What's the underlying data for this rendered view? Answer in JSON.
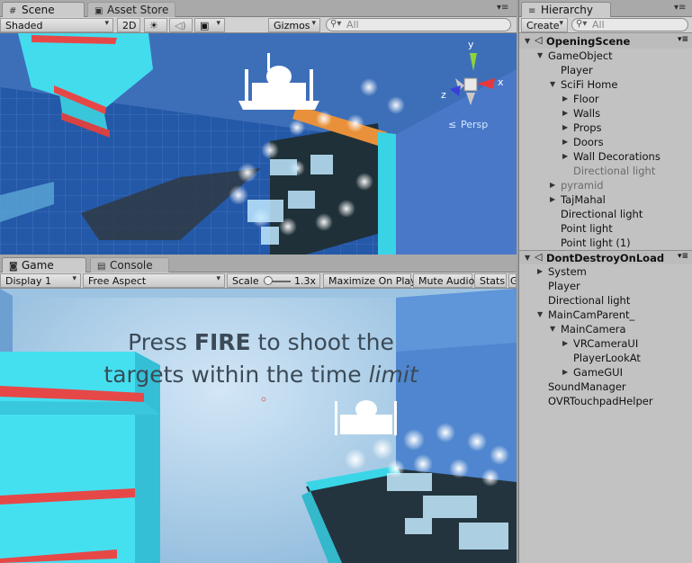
{
  "scene_panel": {
    "tabs": [
      {
        "label": "Scene"
      },
      {
        "label": "Asset Store"
      }
    ],
    "shading_mode": "Shaded",
    "mode_2d": "2D",
    "gizmos": "Gizmos",
    "search_placeholder": "All",
    "gizmo_axis_y": "y",
    "gizmo_axis_x": "x",
    "gizmo_axis_z": "z",
    "persp_label": "Persp"
  },
  "game_panel": {
    "tabs": [
      {
        "label": "Game"
      },
      {
        "label": "Console"
      }
    ],
    "display": "Display 1",
    "aspect": "Free Aspect",
    "scale_label": "Scale",
    "scale_value": "1.3x",
    "maximize_on_play": "Maximize On Play",
    "mute_audio": "Mute Audio",
    "stats": "Stats",
    "gizmos_cut": "G",
    "hud_line1_a": "Press ",
    "hud_line1_b": "FIRE",
    "hud_line1_c": " to shoot the",
    "hud_line2_a": "targets within the time ",
    "hud_line2_b": "limit"
  },
  "hierarchy": {
    "tab": "Hierarchy",
    "create": "Create",
    "search_placeholder": "All",
    "rows": [
      {
        "label": "OpeningScene",
        "depth": 0,
        "arrow": "down",
        "type": "scene"
      },
      {
        "label": "GameObject",
        "depth": 1,
        "arrow": "down"
      },
      {
        "label": "Player",
        "depth": 2,
        "arrow": ""
      },
      {
        "label": "SciFi Home",
        "depth": 2,
        "arrow": "down"
      },
      {
        "label": "Floor",
        "depth": 3,
        "arrow": "right"
      },
      {
        "label": "Walls",
        "depth": 3,
        "arrow": "right"
      },
      {
        "label": "Props",
        "depth": 3,
        "arrow": "right"
      },
      {
        "label": "Doors",
        "depth": 3,
        "arrow": "right"
      },
      {
        "label": "Wall Decorations",
        "depth": 3,
        "arrow": "right"
      },
      {
        "label": "Directional light",
        "depth": 3,
        "arrow": "",
        "dim": true
      },
      {
        "label": "pyramid",
        "depth": 2,
        "arrow": "right",
        "dim": true
      },
      {
        "label": "TajMahal",
        "depth": 2,
        "arrow": "right"
      },
      {
        "label": "Directional light",
        "depth": 2,
        "arrow": ""
      },
      {
        "label": "Point light",
        "depth": 2,
        "arrow": ""
      },
      {
        "label": "Point light (1)",
        "depth": 2,
        "arrow": ""
      },
      {
        "label": "DontDestroyOnLoad",
        "depth": 0,
        "arrow": "down",
        "type": "scene2"
      },
      {
        "label": "System",
        "depth": 1,
        "arrow": "right"
      },
      {
        "label": "Player",
        "depth": 1,
        "arrow": ""
      },
      {
        "label": "Directional light",
        "depth": 1,
        "arrow": ""
      },
      {
        "label": "MainCamParent_",
        "depth": 1,
        "arrow": "down"
      },
      {
        "label": "MainCamera",
        "depth": 2,
        "arrow": "down"
      },
      {
        "label": "VRCameraUI",
        "depth": 3,
        "arrow": "right"
      },
      {
        "label": "PlayerLookAt",
        "depth": 3,
        "arrow": ""
      },
      {
        "label": "GameGUI",
        "depth": 3,
        "arrow": "right"
      },
      {
        "label": "SoundManager",
        "depth": 1,
        "arrow": ""
      },
      {
        "label": "OVRTouchpadHelper",
        "depth": 1,
        "arrow": ""
      }
    ]
  },
  "colors": {
    "editor_bg": "#a2a2a2",
    "scene_wall": "#3d7fd4",
    "cyan_block": "#3ad6e8",
    "red_stripe": "#e64848"
  }
}
